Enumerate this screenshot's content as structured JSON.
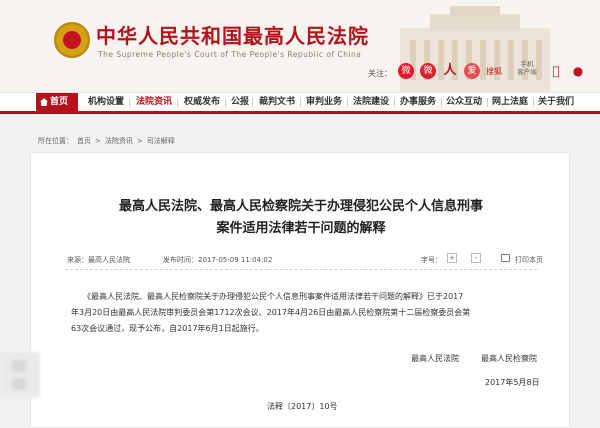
{
  "header": {
    "title": "中华人民共和国最高人民法院",
    "subtitle": "The Supreme People's Court of The People's Republic of China",
    "follow_label": "关注：",
    "social": {
      "weibo": "微",
      "wechat": "微",
      "renmin": "人",
      "ai": "爱",
      "souhu": "搜狐",
      "mobile": "手机\n客户端",
      "apple": "",
      "android": "♞"
    }
  },
  "nav": {
    "items": [
      "首页",
      "机构设置",
      "法院资讯",
      "权威发布",
      "公报",
      "裁判文书",
      "审判业务",
      "法院建设",
      "办事服务",
      "公众互动",
      "网上法庭",
      "关于我们"
    ]
  },
  "breadcrumb": {
    "location_label": "所在位置：",
    "items": [
      "首页",
      "法院资讯",
      "司法解释"
    ]
  },
  "article": {
    "title_line1": "最高人民法院、最高人民检察院关于办理侵犯公民个人信息刑事",
    "title_line2": "案件适用法律若干问题的解释",
    "source": "来源：最高人民法院",
    "publish_time": "发布时间：2017-05-09 11:04:02",
    "font_size_label": "字号：",
    "font_plus": "+",
    "font_minus": "-",
    "print_label": "打印本页",
    "para1": "《最高人民法院、最高人民检察院关于办理侵犯公民个人信息刑事案件适用法律若干问题的解释》已于2017",
    "para2": "年3月20日由最高人民法院审判委员会第1712次会议、2017年4月26日由最高人民检察院第十二届检察委员会第",
    "para3": "63次会议通过，现予公布，自2017年6月1日起施行。",
    "signatory1": "最高人民法院",
    "signatory2": "最高人民检察院",
    "date": "2017年5月8日",
    "doc_number": "法释〔2017〕10号"
  }
}
